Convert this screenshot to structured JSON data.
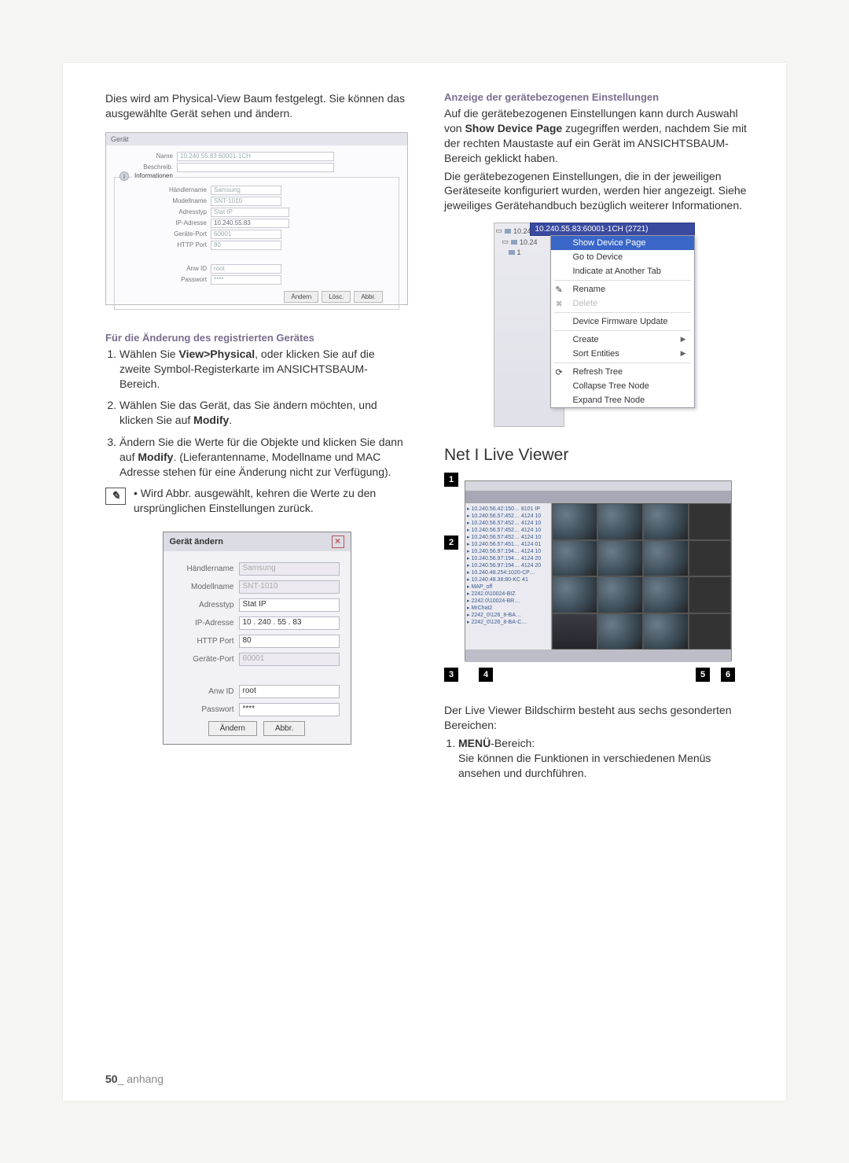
{
  "leftIntro": {
    "p1": "Dies wird am Physical-View Baum festgelegt. Sie können das ausgewählte Gerät sehen und ändern."
  },
  "shot1": {
    "titlePrefix": "Gerät",
    "nameLabel": "Name",
    "nameVal": "10.240.55.83:60001-1CH",
    "descLabel": "Beschreib.",
    "infoTab": "Informationen",
    "rows": {
      "vendorLabel": "Händlername",
      "vendorVal": "Samsung",
      "modelLabel": "Modellname",
      "modelVal": "SNT-1010",
      "addrTypeLabel": "Adresstyp",
      "addrTypeVal": "Stat IP",
      "ipLabel": "IP-Adresse",
      "ipVal": "10.240.55.83",
      "devPortLabel": "Geräte-Port",
      "devPortVal": "60001",
      "httpLabel": "HTTP Port",
      "httpVal": "80",
      "userLabel": "Anw ID",
      "userVal": "root",
      "pwLabel": "Passwort",
      "pwVal": "****"
    },
    "btnModify": "Ändern",
    "btnDel": "Lösc.",
    "btnCancel": "Abbr."
  },
  "leftSubhead": "Für die Änderung des registrierten Gerätes",
  "steps": {
    "s1a": "Wählen Sie ",
    "s1b": "View>Physical",
    "s1c": ", oder klicken Sie auf die zweite Symbol-Registerkarte im ANSICHTSBAUM-Bereich.",
    "s2a": "Wählen Sie das Gerät, das Sie ändern möchten, und klicken Sie auf ",
    "s2b": "Modify",
    "s2c": ".",
    "s3a": "Ändern Sie die Werte für die Objekte und klicken Sie dann auf ",
    "s3b": "Modify",
    "s3c": ". (Lieferantenname, Modellname und MAC Adresse stehen für eine Änderung nicht zur Verfügung)."
  },
  "note": "Wird Abbr. ausgewählt, kehren die Werte zu den ursprünglichen Einstellungen zurück.",
  "dlg": {
    "title": "Gerät ändern",
    "vendorLabel": "Händlername",
    "vendorVal": "Samsung",
    "modelLabel": "Modellname",
    "modelVal": "SNT-1010",
    "addrTypeLabel": "Adresstyp",
    "addrTypeVal": "Stat IP",
    "ipLabel": "IP-Adresse",
    "ipVal": "10 . 240 . 55 . 83",
    "httpLabel": "HTTP Port",
    "httpVal": "80",
    "devPortLabel": "Geräte-Port",
    "devPortVal": "60001",
    "userLabel": "Anw ID",
    "userVal": "root",
    "pwLabel": "Passwort",
    "pwVal": "****",
    "btnModify": "Ändern",
    "btnCancel": "Abbr."
  },
  "rightHead": "Anzeige der gerätebezogenen Einstellungen",
  "rightPara1a": "Auf die gerätebezogenen Einstellungen kann durch Auswahl von ",
  "rightPara1b": "Show Device Page",
  "rightPara1c": " zugegriffen werden, nachdem Sie mit der rechten Maustaste auf ein Gerät im ANSICHTSBAUM-Bereich geklickt haben.",
  "rightPara2": "Die gerätebezogenen Einstellungen, die in der jeweiligen Geräteseite konfiguriert wurden, werden hier angezeigt. Siehe jeweiliges Gerätehandbuch bezüglich weiterer Informationen.",
  "ctx": {
    "headerNode": "10.240.55.83:60001-1CH (2721)",
    "treeNode": "10.24",
    "items": [
      "Show Device Page",
      "Go to Device",
      "Indicate at Another Tab",
      "Rename",
      "Delete",
      "Device Firmware Update",
      "Create",
      "Sort Entities",
      "Refresh Tree",
      "Collapse Tree Node",
      "Expand Tree Node"
    ]
  },
  "liveHead": "Net I Live Viewer",
  "treeNodes": [
    "10.240.56.42:150… 8101 IP",
    "10.240.56.57:452… 4124 10",
    "10.240.56.57:452… 4124 10",
    "10.240.56.57:452… 4124 10",
    "10.240.56.57:452… 4124 10",
    "10.240.56.57:451… 4124 01",
    "10.240.56.97:194… 4124 10",
    "10.240.56.97:194… 4124 20",
    "10.240.56.97:194… 4124 20",
    "10.240.48.254:1020-CP…",
    "10.240.48.38:80-KC 41",
    "MAP_off",
    "2242.0\\10024-BIZ",
    "2242.0\\10024-BR…",
    "MrChat2",
    "2242_0\\126_8-BA…",
    "2242_0\\126_8-BA-C…"
  ],
  "liveCaption": "Der Live Viewer Bildschirm besteht aus sechs gesonderten Bereichen:",
  "liveItem1a": "MENÜ",
  "liveItem1b": "-Bereich:",
  "liveItem1c": "Sie können die Funktionen in verschiedenen Menüs ansehen und durchführen.",
  "footer": {
    "page": "50",
    "section": "anhang"
  }
}
